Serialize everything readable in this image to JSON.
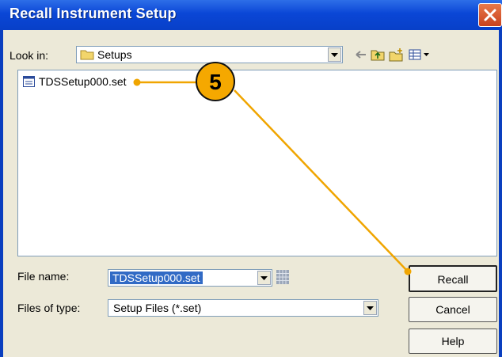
{
  "window": {
    "title": "Recall Instrument Setup"
  },
  "look_in": {
    "label": "Look in:",
    "value": "Setups"
  },
  "files": [
    {
      "name": "TDSSetup000.set"
    }
  ],
  "file_name": {
    "label": "File name:",
    "value": "TDSSetup000.set"
  },
  "files_of_type": {
    "label": "Files of type:",
    "value": "Setup Files (*.set)"
  },
  "buttons": {
    "recall": "Recall",
    "cancel": "Cancel",
    "help": "Help"
  },
  "callout": {
    "number": "5"
  },
  "icons": [
    "close-icon",
    "folder-icon",
    "back-icon",
    "up-folder-icon",
    "new-folder-icon",
    "view-menu-icon",
    "file-icon",
    "keyboard-icon",
    "chevron-down-icon"
  ],
  "colors": {
    "titlebar": "#0a46d6",
    "callout": "#f0a500",
    "selection": "#316ac5"
  }
}
